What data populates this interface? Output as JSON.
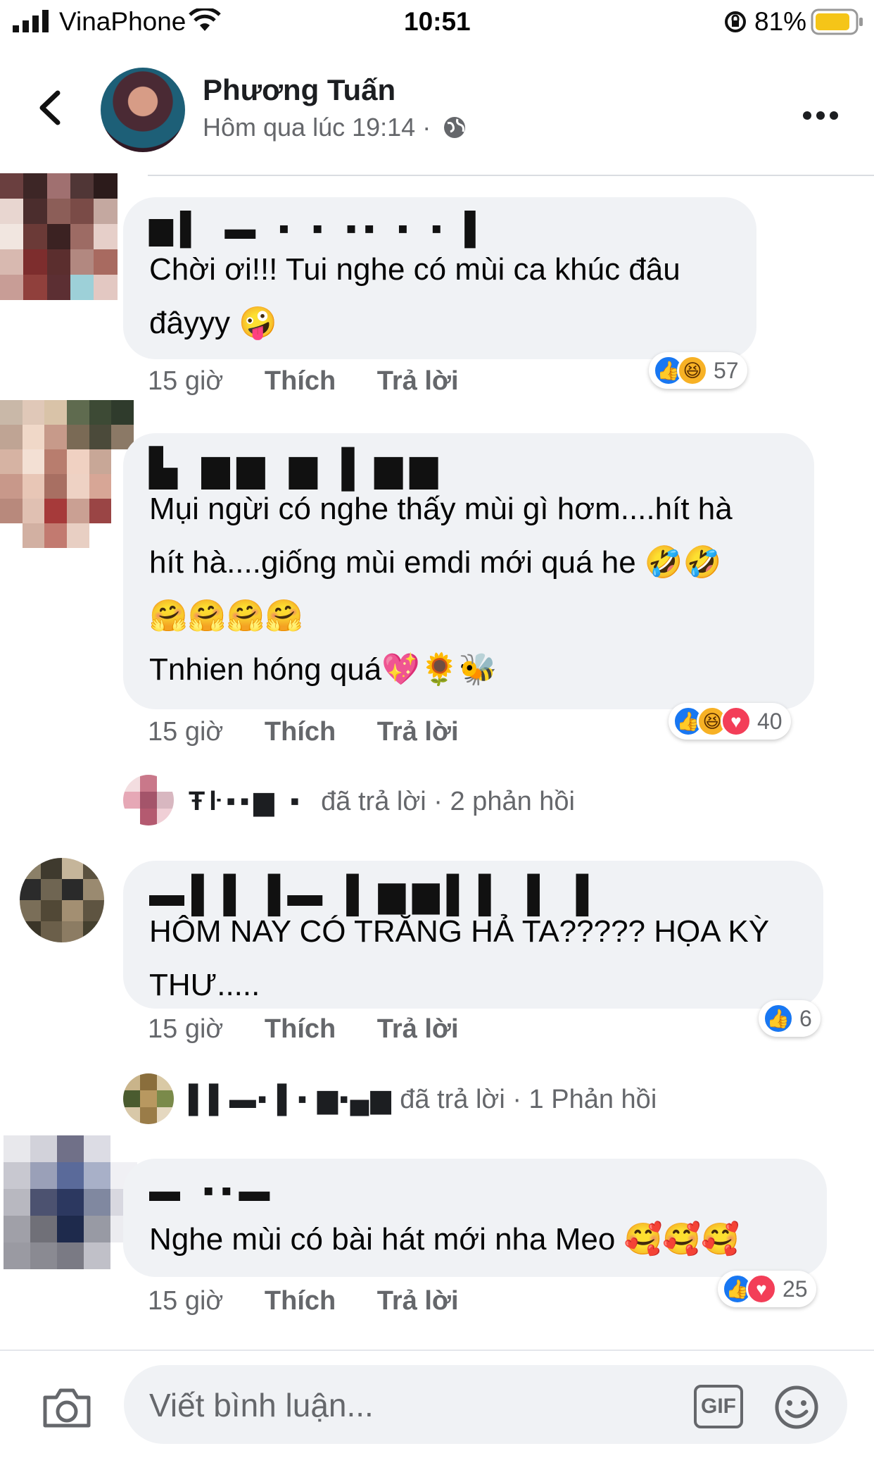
{
  "status_bar": {
    "carrier": "VinaPhone",
    "time": "10:51",
    "battery": "81%"
  },
  "post_header": {
    "author": "Phương Tuấn",
    "meta": "Hôm qua lúc 19:14 ·",
    "privacy_icon": "globe-icon",
    "more_icon": "more-dots-icon",
    "back_icon": "chevron-left-icon"
  },
  "comments": [
    {
      "text": "Chời ơi!!! Tui nghe có mùi ca khúc đâu\nđâyyy 🤪",
      "time": "15 giờ",
      "like": "Thích",
      "reply": "Trả lời",
      "reactions": [
        "like",
        "haha"
      ],
      "reaction_count": "57"
    },
    {
      "text": "Mụi ngừi có nghe thấy mùi gì hơm....hít hà\nhít hà....giống mùi emdi mới quá he 🤣🤣\n🤗🤗🤗🤗\nTnhien hóng quá💖🌻🐝",
      "time": "15 giờ",
      "like": "Thích",
      "reply": "Trả lời",
      "reactions": [
        "like",
        "haha",
        "love"
      ],
      "reaction_count": "40",
      "replies_summary": {
        "replied": "đã trả lời",
        "count": "· 2 phản hồi"
      }
    },
    {
      "text": "HÔM NAY CÓ TRĂNG HẢ TA????? HỌA KỲ\nTHƯ.....",
      "time": "15 giờ",
      "like": "Thích",
      "reply": "Trả lời",
      "reactions": [
        "like"
      ],
      "reaction_count": "6",
      "replies_summary": {
        "replied": "đã trả lời",
        "count": "· 1 Phản hồi"
      }
    },
    {
      "text": "Nghe mùi có bài hát mới nha Meo 🥰🥰🥰",
      "time": "15 giờ",
      "like": "Thích",
      "reply": "Trả lời",
      "reactions": [
        "like",
        "love"
      ],
      "reaction_count": "25"
    }
  ],
  "composer": {
    "placeholder": "Viết bình luận...",
    "gif_label": "GIF",
    "camera_icon": "camera-icon",
    "emoji_icon": "smiley-icon"
  },
  "colors": {
    "like_blue": "#1877f2",
    "love_red": "#f33e58",
    "haha_yellow": "#f7b125",
    "bubble_bg": "#f0f2f5",
    "muted_text": "#65676b"
  }
}
